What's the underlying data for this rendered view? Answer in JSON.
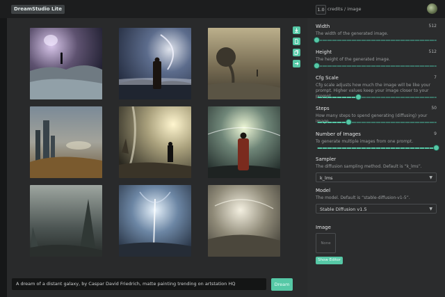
{
  "app": {
    "brand": "DreamStudio Lite"
  },
  "header": {
    "credits_value": "1.0",
    "credits_label": "credits / image"
  },
  "images": [
    {
      "label": "dream-image-1"
    },
    {
      "label": "dream-image-2"
    },
    {
      "label": "dream-image-3"
    },
    {
      "label": "dream-image-4"
    },
    {
      "label": "dream-image-5"
    },
    {
      "label": "dream-image-6"
    },
    {
      "label": "dream-image-7"
    },
    {
      "label": "dream-image-8"
    },
    {
      "label": "dream-image-9"
    }
  ],
  "tools": [
    "download-icon",
    "file-icon",
    "copy-icon",
    "arrow-icon"
  ],
  "prompt": {
    "text": "A dream of a distant galaxy, by Caspar David Friedrich, matte painting trending on artstation HQ",
    "button": "Dream"
  },
  "settings": {
    "width": {
      "label": "Width",
      "value": "512",
      "desc": "The width of the generated image.",
      "fraction": 0.0
    },
    "height": {
      "label": "Height",
      "value": "512",
      "desc": "The height of the generated image.",
      "fraction": 0.0
    },
    "cfg": {
      "label": "Cfg Scale",
      "value": "7",
      "desc": "Cfg scale adjusts how much the image will be like your prompt. Higher values keep your image closer to your prompt.",
      "fraction": 0.35
    },
    "steps": {
      "label": "Steps",
      "value": "50",
      "desc": "How many steps to spend generating (diffusing) your image.",
      "fraction": 0.27
    },
    "num_images": {
      "label": "Number of Images",
      "value": "9",
      "desc": "To generate multiple images from one prompt.",
      "fraction": 1.0
    },
    "sampler": {
      "label": "Sampler",
      "desc": "The diffusion sampling method. Default is “k_lms”.",
      "selected": "k_lms"
    },
    "model": {
      "label": "Model",
      "desc": "The model. Default is “stable-diffusion-v1-5”.",
      "selected": "Stable Diffusion v1.5"
    },
    "image": {
      "label": "Image",
      "placeholder": "None",
      "button": "Show Editor"
    }
  },
  "colors": {
    "accent": "#56c8a6",
    "panel": "#2b2c2d",
    "main": "#292a2b"
  }
}
